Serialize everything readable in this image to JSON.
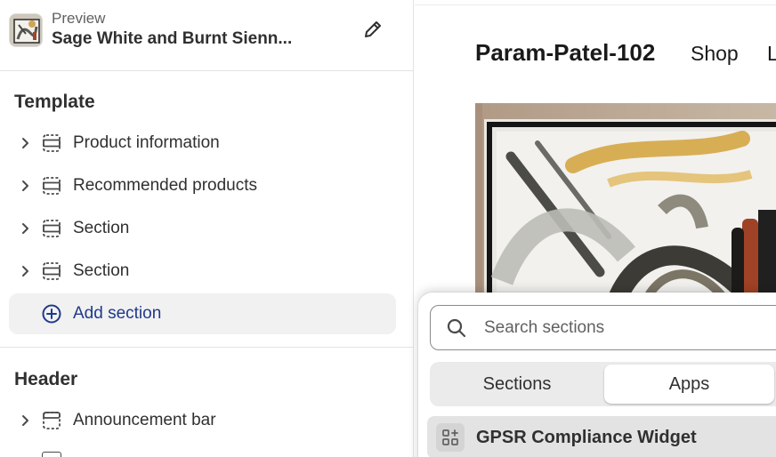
{
  "preview": {
    "label": "Preview",
    "title": "Sage White and Burnt Sienn..."
  },
  "template": {
    "title": "Template",
    "items": [
      {
        "label": "Product information"
      },
      {
        "label": "Recommended products"
      },
      {
        "label": "Section"
      },
      {
        "label": "Section"
      }
    ],
    "add_label": "Add section"
  },
  "header": {
    "title": "Header",
    "items": [
      {
        "label": "Announcement bar"
      }
    ]
  },
  "store": {
    "name": "Param-Patel-102",
    "nav": [
      "Shop",
      "L"
    ]
  },
  "picker": {
    "search_placeholder": "Search sections",
    "tabs": [
      "Sections",
      "Apps"
    ],
    "selected_tab": "Apps",
    "apps": [
      {
        "label": "GPSR Compliance Widget"
      }
    ]
  },
  "icons": {
    "edit": "pencil-icon",
    "chevron": "chevron-right-icon",
    "section": "section-layout-icon",
    "add": "plus-circle-icon",
    "search": "search-icon",
    "app": "app-blocks-icon"
  },
  "colors": {
    "accent": "#1f3a8a",
    "border": "#e3e3e3",
    "text": "#303030"
  }
}
